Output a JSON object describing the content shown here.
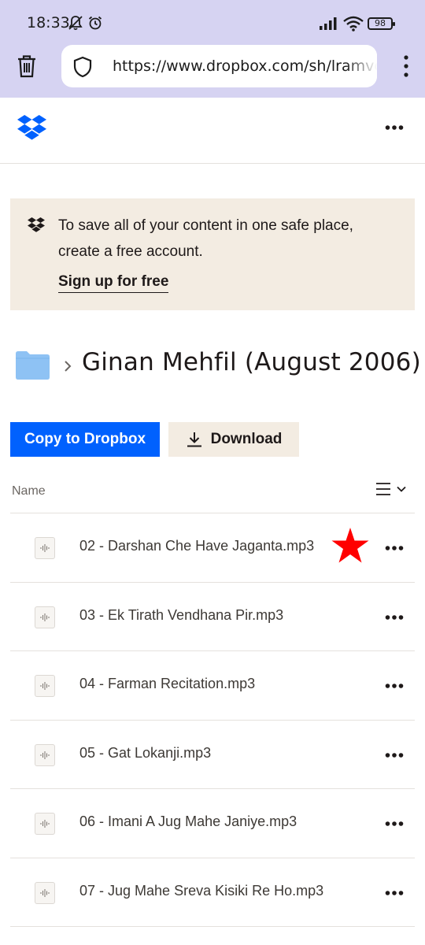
{
  "status_bar": {
    "time": "18:33",
    "battery": "98"
  },
  "browser": {
    "url": "https://www.dropbox.com/sh/lramvc"
  },
  "banner": {
    "text": "To save all of your content in one safe place, create a free account.",
    "signup_label": "Sign up for free"
  },
  "folder": {
    "title": "Ginan Mehfil (August 2006)"
  },
  "actions": {
    "copy_label": "Copy to Dropbox",
    "download_label": "Download"
  },
  "list": {
    "name_header": "Name",
    "files": [
      {
        "name": "02 - Darshan Che Have Jaganta.mp3"
      },
      {
        "name": "03 - Ek Tirath Vendhana Pir.mp3"
      },
      {
        "name": "04 - Farman Recitation.mp3"
      },
      {
        "name": "05 - Gat Lokanji.mp3"
      },
      {
        "name": "06 - Imani A Jug Mahe Janiye.mp3"
      },
      {
        "name": "07 - Jug Mahe Sreva Kisiki Re Ho.mp3"
      }
    ]
  },
  "colors": {
    "chrome_bg": "#d6d3f2",
    "dropbox_blue": "#0061fe",
    "banner_bg": "#f3ece2",
    "folder_blue": "#8ec2f4",
    "star_red": "#ff0000"
  },
  "icons": [
    "mute-icon",
    "alarm-icon",
    "signal-icon",
    "wifi-icon",
    "battery-icon",
    "trash-icon",
    "shield-icon",
    "more-vert-icon",
    "dropbox-logo-icon",
    "more-horiz-icon",
    "folder-icon",
    "chevron-right-icon",
    "download-icon",
    "list-view-icon",
    "chevron-down-icon",
    "audio-file-icon",
    "star-marker-icon"
  ]
}
